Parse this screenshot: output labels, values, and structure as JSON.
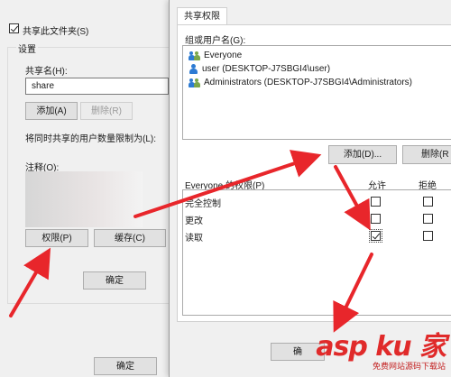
{
  "back_dialog": {
    "share_checkbox_label": "共享此文件夹(S)",
    "settings_group": "设置",
    "share_name_label": "共享名(H):",
    "share_name_value": "share",
    "add_button": "添加(A)",
    "delete_button": "删除(R)",
    "limit_label": "将同时共享的用户数量限制为(L):",
    "comment_label": "注释(O):",
    "permissions_button": "权限(P)",
    "cache_button": "缓存(C)",
    "ok_button": "确定",
    "ok_button_bottom": "确定"
  },
  "front_dialog": {
    "tab_label": "共享权限",
    "groups_label": "组或用户名(G):",
    "users": [
      {
        "name": "Everyone",
        "icon": "group-icon"
      },
      {
        "name": "user (DESKTOP-J7SBGI4\\user)",
        "icon": "user-icon"
      },
      {
        "name": "Administrators (DESKTOP-J7SBGI4\\Administrators)",
        "icon": "group-icon"
      }
    ],
    "add_button": "添加(D)...",
    "remove_button": "删除(R",
    "perm_header": "Everyone 的权限(P)",
    "allow_header": "允许",
    "deny_header": "拒绝",
    "permissions": [
      {
        "name": "完全控制",
        "allow": false,
        "deny": false
      },
      {
        "name": "更改",
        "allow": false,
        "deny": false
      },
      {
        "name": "读取",
        "allow": true,
        "deny": false
      }
    ],
    "ok_button": "确"
  },
  "watermark": {
    "brand": "asp ku 家",
    "subtitle": "免费网站源码下载站"
  },
  "colors": {
    "arrow": "#e8262b",
    "user_icon": "#2d7bd3",
    "dialog_bg": "#f0f0f0"
  }
}
